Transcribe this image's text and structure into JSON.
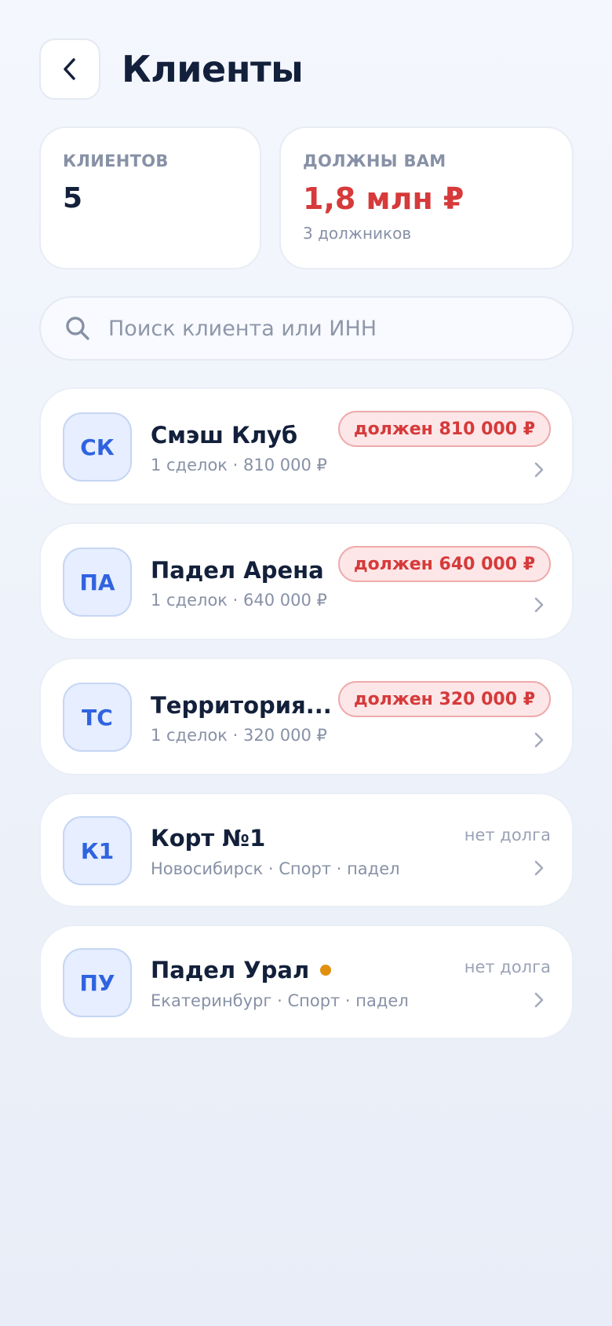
{
  "header": {
    "title": "Клиенты"
  },
  "stats": {
    "clients": {
      "label": "КЛИЕНТОВ",
      "value": "5"
    },
    "owed": {
      "label": "ДОЛЖНЫ ВАМ",
      "value": "1,8 млн ₽",
      "sub": "3 должников"
    }
  },
  "search": {
    "placeholder": "Поиск клиента или ИНН",
    "value": ""
  },
  "clients": [
    {
      "initials": "СК",
      "name": "Смэш Клуб",
      "sub": "1 сделок · 810 000 ₽",
      "badge": "должен 810 000 ₽",
      "has_dot": false
    },
    {
      "initials": "ПА",
      "name": "Падел Арена",
      "sub": "1 сделок · 640 000 ₽",
      "badge": "должен 640 000 ₽",
      "has_dot": false
    },
    {
      "initials": "ТС",
      "name": "Территория...",
      "sub": "1 сделок · 320 000 ₽",
      "badge": "должен 320 000 ₽",
      "has_dot": true
    },
    {
      "initials": "К1",
      "name": "Корт №1",
      "sub": "Новосибирск · Спорт · падел",
      "status": "нет долга",
      "has_dot": false
    },
    {
      "initials": "ПУ",
      "name": "Падел Урал",
      "sub": "Екатеринбург · Спорт · падел",
      "status": "нет долга",
      "has_dot": true
    }
  ],
  "colors": {
    "accent": "#2f63e0",
    "danger": "#d63a3a",
    "dot": "#e0900d"
  }
}
